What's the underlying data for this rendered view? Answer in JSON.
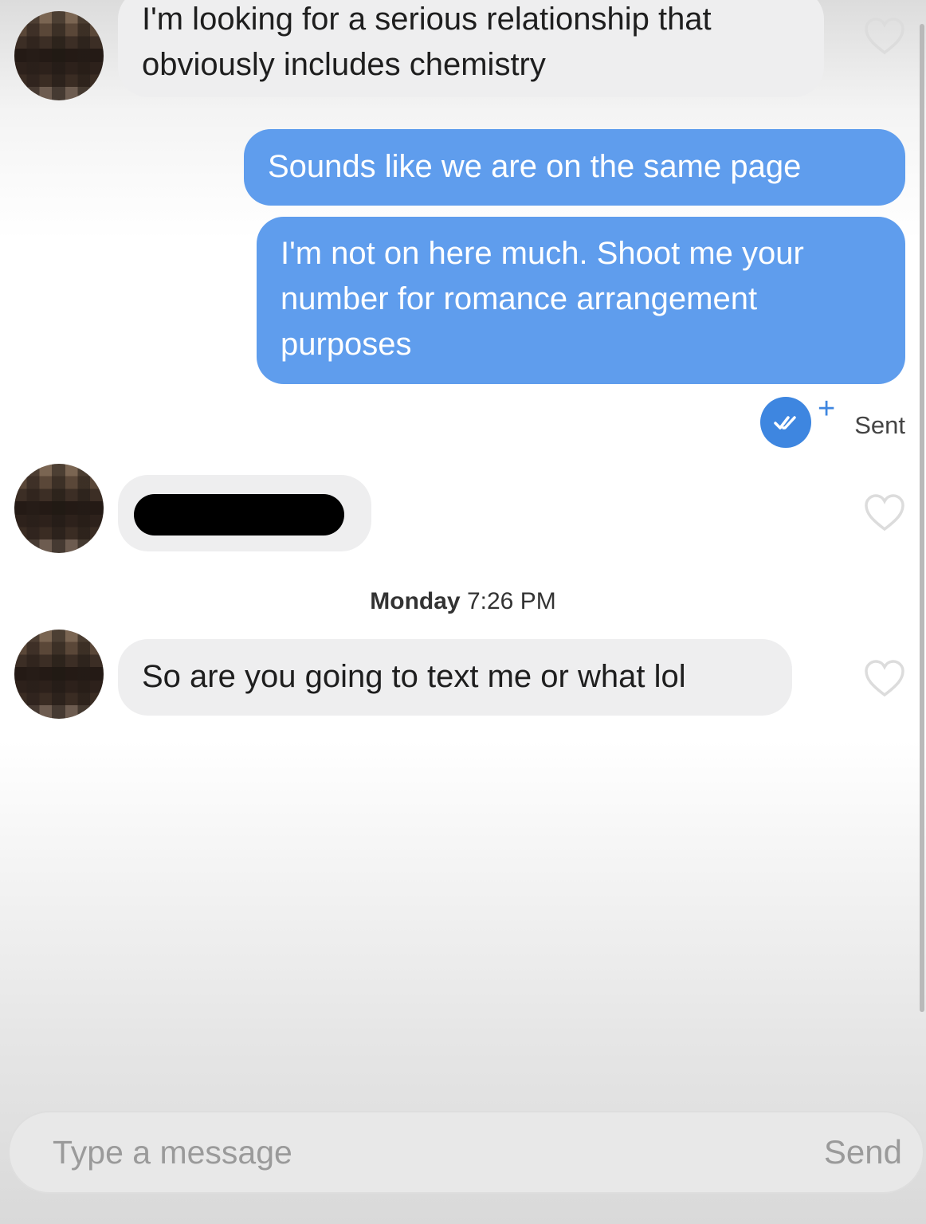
{
  "messages": {
    "received_1": {
      "text_line_1": "I'm looking for a serious relationship that",
      "text_line_2": "obviously includes chemistry"
    },
    "sent_1": {
      "text": "Sounds like we are on the same page"
    },
    "sent_2": {
      "text_line_1": "I'm not on here much. Shoot me your",
      "text_line_2": "number for romance arrangement",
      "text_line_3": "purposes"
    },
    "received_2": {
      "text": ""
    },
    "received_3": {
      "text": "So are you going to text me or what lol"
    }
  },
  "status": {
    "sent_label": "Sent",
    "plus": "+"
  },
  "timestamp": {
    "day": "Monday",
    "time": "7:26 PM"
  },
  "composer": {
    "placeholder": "Type a message",
    "send_label": "Send"
  },
  "colors": {
    "outgoing_bubble": "#5f9ded",
    "incoming_bubble": "#eeeeef",
    "accent": "#3e86e0"
  }
}
